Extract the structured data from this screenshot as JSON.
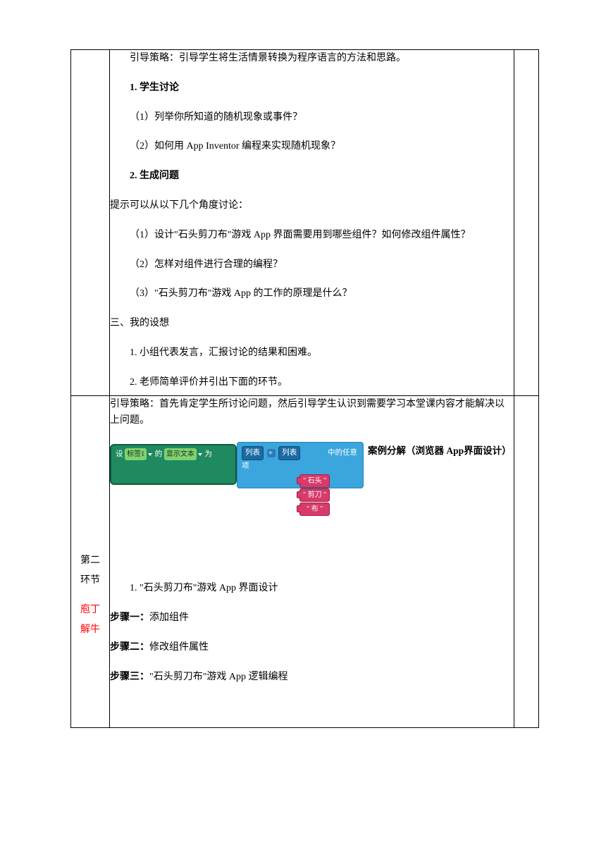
{
  "row1": {
    "guide": "引导策略：引导学生将生活情景转换为程序语言的方法和思路。",
    "h1": "1. 学生讨论",
    "q1": "（1）列举你所知道的随机现象或事件？",
    "q2": "（2）如何用 App Inventor 编程来实现随机现象？",
    "h2": "2. 生成问题",
    "hint": "提示可以从以下几个角度讨论：",
    "p1": "（1）设计\"石头剪刀布\"游戏 App 界面需要用到哪些组件？如何修改组件属性？",
    "p2": "（2）怎样对组件进行合理的编程？",
    "p3": "（3）\"石头剪刀布\"游戏 App 的工作的原理是什么？",
    "sec3": "三、我的设想",
    "s1": "1. 小组代表发言，汇报讨论的结果和困难。",
    "s2": "2. 老师简单评价并引出下面的环节。"
  },
  "row2": {
    "label_line1": "第二",
    "label_line2": "环节",
    "label_red1": "庖丁",
    "label_red2": "解牛",
    "guide": "引导策略：首先肯定学生所讨论问题，然后引导学生认识到需要学习本堂课内容才能解决以上问题。",
    "caption": "案例分解（浏览器 App界面设计）",
    "block": {
      "set": "设",
      "label1": "标签1",
      "dot1": ".",
      "of": "的",
      "disp": "显示文本",
      "dot2": ".",
      "to": "为",
      "list1": "列表",
      "list2": "列表",
      "opt1": "\" 石头 \"",
      "opt2": "\" 剪刀 \"",
      "opt3": "\"  布  \"",
      "tail": "中的任意项"
    },
    "l1": "1.   \"石头剪刀布\"游戏 App  界面设计",
    "step1_label": "步骤一：",
    "step1": "添加组件",
    "step2_label": "步骤二：",
    "step2": "修改组件属性",
    "step3_label": "步骤三：",
    "step3": "\"石头剪刀布\"游戏 App 逻辑编程"
  }
}
